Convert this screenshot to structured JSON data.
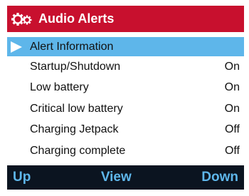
{
  "header": {
    "title": "Audio Alerts",
    "icon": "gears-icon",
    "background": "#c8102e"
  },
  "list": {
    "selected_index": 0,
    "selected_color": "#5eb6ea",
    "items": [
      {
        "label": "Alert Information",
        "value": ""
      },
      {
        "label": "Startup/Shutdown",
        "value": "On"
      },
      {
        "label": "Low battery",
        "value": "On"
      },
      {
        "label": "Critical low battery",
        "value": "On"
      },
      {
        "label": "Charging Jetpack",
        "value": "Off"
      },
      {
        "label": "Charging complete",
        "value": "Off"
      }
    ]
  },
  "footer": {
    "left": "Up",
    "center": "View",
    "right": "Down",
    "text_color": "#5eb6ea",
    "background": "#0b1420"
  }
}
